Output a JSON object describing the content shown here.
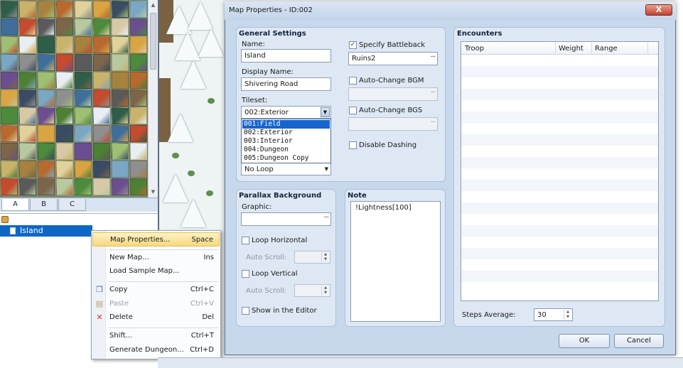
{
  "palette": {
    "tabs": [
      "A",
      "B",
      "C"
    ]
  },
  "map_tree": {
    "selected_map": "Island"
  },
  "context_menu": {
    "items": [
      {
        "label": "Map Properties...",
        "shortcut": "Space"
      },
      {
        "label": "New Map...",
        "shortcut": "Ins"
      },
      {
        "label": "Load Sample Map...",
        "shortcut": ""
      },
      {
        "label": "Copy",
        "shortcut": "Ctrl+C"
      },
      {
        "label": "Paste",
        "shortcut": "Ctrl+V"
      },
      {
        "label": "Delete",
        "shortcut": "Del"
      },
      {
        "label": "Shift...",
        "shortcut": "Ctrl+T"
      },
      {
        "label": "Generate Dungeon...",
        "shortcut": "Ctrl+D"
      }
    ]
  },
  "dialog": {
    "title": "Map Properties - ID:002",
    "close_glyph": "X",
    "general": {
      "heading": "General Settings",
      "name_label": "Name:",
      "name_value": "Island",
      "display_name_label": "Display Name:",
      "display_name_value": "Shivering Road",
      "tileset_label": "Tileset:",
      "tileset_value": "002:Exterior",
      "tileset_options": [
        "001:Field",
        "002:Exterior",
        "003:Interior",
        "004:Dungeon",
        "005:Dungeon Copy"
      ],
      "scroll_value": "No Loop",
      "specify_battleback_label": "Specify Battleback",
      "battleback_value": "Ruins2",
      "auto_bgm_label": "Auto-Change BGM",
      "auto_bgs_label": "Auto-Change BGS",
      "disable_dashing_label": "Disable Dashing",
      "browse_glyph": "···"
    },
    "parallax": {
      "heading": "Parallax Background",
      "graphic_label": "Graphic:",
      "loop_h_label": "Loop Horizontal",
      "auto_scroll_label": "Auto Scroll:",
      "loop_v_label": "Loop Vertical",
      "show_editor_label": "Show in the Editor"
    },
    "note": {
      "heading": "Note",
      "value": "!Lightness[100]"
    },
    "encounters": {
      "heading": "Encounters",
      "columns": [
        "Troop",
        "Weight",
        "Range"
      ],
      "steps_label": "Steps Average:",
      "steps_value": "30"
    },
    "buttons": {
      "ok": "OK",
      "cancel": "Cancel"
    }
  }
}
